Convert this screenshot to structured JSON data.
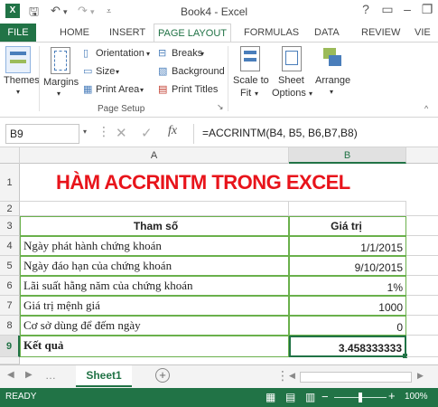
{
  "titlebar": {
    "title": "Book4 - Excel",
    "help": "?"
  },
  "tabs": [
    "FILE",
    "HOME",
    "INSERT",
    "PAGE LAYOUT",
    "FORMULAS",
    "DATA",
    "REVIEW",
    "VIE"
  ],
  "ribbon": {
    "themes": "Themes",
    "margins": "Margins",
    "orientation": "Orientation",
    "size": "Size",
    "print_area": "Print Area",
    "breaks": "Breaks",
    "background": "Background",
    "print_titles": "Print Titles",
    "scale_to_fit_1": "Scale to",
    "scale_to_fit_2": "Fit",
    "sheet_options_1": "Sheet",
    "sheet_options_2": "Options",
    "arrange": "Arrange",
    "group_label": "Page Setup"
  },
  "formula_bar": {
    "name_box": "B9",
    "fx": "fx",
    "formula": "=ACCRINTM(B4, B5, B6,B7,B8)"
  },
  "columns": [
    "A",
    "B"
  ],
  "sheet": {
    "title": "HÀM ACCRINTM TRONG EXCEL",
    "header_a": "Tham số",
    "header_b": "Giá trị",
    "rows": [
      {
        "n": "4",
        "a": "Ngày phát hành chứng khoán",
        "b": "1/1/2015"
      },
      {
        "n": "5",
        "a": "Ngày đáo hạn của chứng khoán",
        "b": "9/10/2015"
      },
      {
        "n": "6",
        "a": "Lãi suất hằng năm của chứng khoán",
        "b": "1%"
      },
      {
        "n": "7",
        "a": "Giá trị mệnh giá",
        "b": "1000"
      },
      {
        "n": "8",
        "a": "Cơ sở dùng để đếm ngày",
        "b": "0"
      },
      {
        "n": "9",
        "a": "Kết quả",
        "b": "3.458333333"
      }
    ],
    "row_nums": [
      "1",
      "2",
      "3"
    ]
  },
  "sheet_tabs": {
    "active": "Sheet1"
  },
  "status": {
    "ready": "READY",
    "zoom": "100%",
    "minus": "−",
    "plus": "+"
  },
  "colors": {
    "excel_green": "#217346",
    "title_red": "#e8141b",
    "border_green": "#6ab04c"
  }
}
